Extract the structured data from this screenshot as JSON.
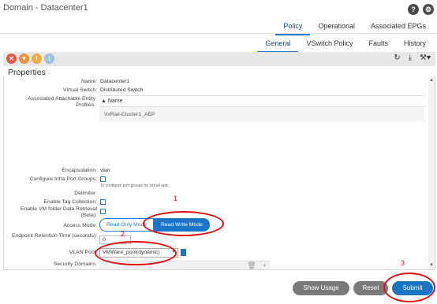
{
  "window": {
    "title": "Domain - Datacenter1"
  },
  "top_icons": [
    "help-icon",
    "settings-icon"
  ],
  "tabs_primary": [
    "Policy",
    "Operational",
    "Associated EPGs"
  ],
  "tabs_secondary": [
    "General",
    "VSwitch Policy",
    "Faults",
    "History"
  ],
  "section_title": "Properties",
  "fields": {
    "name_label": "Name:",
    "name_value": "Datacenter1",
    "vswitch_label": "Virtual Switch:",
    "vswitch_value": "Distributed Switch",
    "aaep_label": "Associated Attachable Entity Profiles:",
    "aaep_col": "Name",
    "aaep_row": "VxRail-Cluster1_AEP",
    "encap_label": "Encapsulation:",
    "encap_value": "vlan",
    "infra_label": "Configure Infra Port Groups:",
    "infra_hint": "To configure port groups for virtual epic",
    "delim_label": "Delimiter:",
    "tag_label": "Enable Tag Collection:",
    "vmfolder_label": "Enable VM folder Data Retrieval (Beta):",
    "access_label": "Access Mode:",
    "access_opt1": "Read Only Mode",
    "access_opt2": "Read Write Mode",
    "retention_label": "Endpoint Retention Time (seconds):",
    "retention_value": "0",
    "vlan_label": "VLAN Pool:",
    "vlan_value": "VMWare_pool(dynamic)",
    "secdom_label": "Security Domains:"
  },
  "buttons": {
    "show_usage": "Show Usage",
    "reset": "Reset",
    "submit": "Submit"
  },
  "annotations": {
    "n1": "1",
    "n2": "2",
    "n3": "3"
  },
  "colors": {
    "accent": "#1b74c4",
    "annotation": "#e01010"
  }
}
